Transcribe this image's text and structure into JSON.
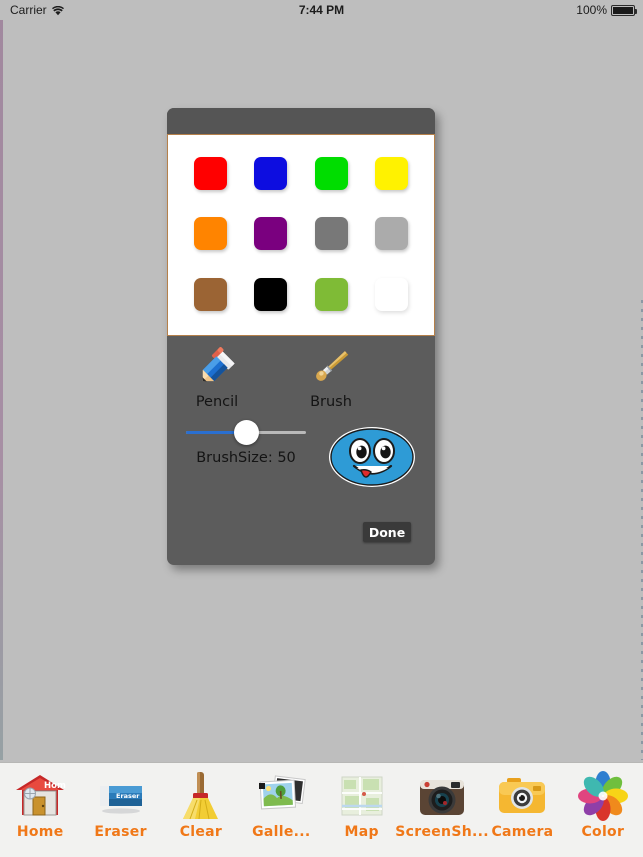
{
  "status_bar": {
    "carrier": "Carrier",
    "wifi_icon": "wifi-icon",
    "time": "7:44 PM",
    "battery_percent": "100%",
    "battery_icon": "battery-icon"
  },
  "color_modal": {
    "swatches": [
      {
        "name": "red",
        "hex": "#FF0000"
      },
      {
        "name": "blue",
        "hex": "#0D0DE0"
      },
      {
        "name": "green",
        "hex": "#00DD00"
      },
      {
        "name": "yellow",
        "hex": "#FFF200"
      },
      {
        "name": "orange",
        "hex": "#FF8400"
      },
      {
        "name": "purple",
        "hex": "#7A007F"
      },
      {
        "name": "dark-gray",
        "hex": "#787878"
      },
      {
        "name": "light-gray",
        "hex": "#ABABAB"
      },
      {
        "name": "brown",
        "hex": "#9B6434"
      },
      {
        "name": "black",
        "hex": "#000000"
      },
      {
        "name": "lime",
        "hex": "#7FBB36"
      },
      {
        "name": "white",
        "hex": "#FFFFFF"
      }
    ],
    "tools": [
      {
        "name": "pencil",
        "label": "Pencil",
        "icon": "pencil-icon"
      },
      {
        "name": "brush",
        "label": "Brush",
        "icon": "brush-icon"
      }
    ],
    "brush_size": {
      "label": "BrushSize: 50",
      "value": 50,
      "min": 0,
      "max": 100,
      "fill_color": "#2A6FD0",
      "track_color": "#B9B9B9"
    },
    "face_preview": {
      "icon": "smiley-face-icon",
      "color": "#2E9BD6"
    },
    "done_label": "Done",
    "header_color": "#555555",
    "body_color": "#5C5C5C",
    "palette_border": "#B5804A"
  },
  "toolbar": {
    "items": [
      {
        "name": "home",
        "label": "Home",
        "icon": "house-icon"
      },
      {
        "name": "eraser",
        "label": "Eraser",
        "icon": "eraser-icon"
      },
      {
        "name": "clear",
        "label": "Clear",
        "icon": "broom-icon"
      },
      {
        "name": "gallery",
        "label": "Galle...",
        "icon": "photos-icon"
      },
      {
        "name": "map",
        "label": "Map",
        "icon": "map-icon"
      },
      {
        "name": "screenshot",
        "label": "ScreenSh...",
        "icon": "retro-camera-icon"
      },
      {
        "name": "camera",
        "label": "Camera",
        "icon": "camera-icon"
      },
      {
        "name": "color",
        "label": "Color",
        "icon": "color-flower-icon"
      }
    ],
    "label_color": "#F07818",
    "background": "#F2F2F0"
  },
  "canvas": {
    "background": "#BEBEBE"
  }
}
